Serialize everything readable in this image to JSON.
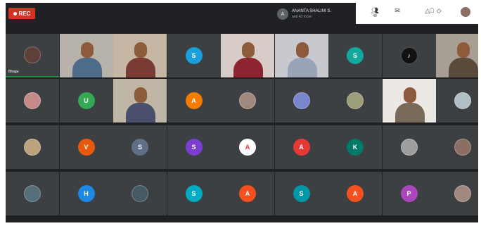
{
  "recording": {
    "label": "REC",
    "accent": "#d93025"
  },
  "presenter": {
    "initial": "A",
    "name": "ANANTA SHALINI S.",
    "status": "and 43 more"
  },
  "controls": {
    "people": {
      "icon": "people-icon",
      "count": "48"
    },
    "chat": {
      "icon": "chat-icon"
    },
    "activities": {
      "icon": "activities-icon"
    },
    "self": {
      "icon": "self-avatar"
    }
  },
  "colors": {
    "background": "#202124",
    "tile": "#3c4043",
    "speaking": "#1e8e3e"
  },
  "tiles": [
    {
      "kind": "photo",
      "initial": "",
      "color": "#5d4037",
      "name": "Bhagu"
    },
    {
      "kind": "video",
      "bg": "#b7b2aa",
      "shirt": "#4e6b8a"
    },
    {
      "kind": "video",
      "bg": "#c6b6a3",
      "shirt": "#7a3b32"
    },
    {
      "kind": "avatar",
      "initial": "S",
      "color": "#1a9fd8"
    },
    {
      "kind": "video",
      "bg": "#d7ccc8",
      "shirt": "#8e2430"
    },
    {
      "kind": "video",
      "bg": "#c8c9cf",
      "shirt": "#9aa4b8"
    },
    {
      "kind": "avatar",
      "initial": "S",
      "color": "#12a89d"
    },
    {
      "kind": "photo",
      "initial": "♪",
      "color": "#111111"
    },
    {
      "kind": "video",
      "bg": "#a89f94",
      "shirt": "#5a4a3a"
    },
    {
      "kind": "photo",
      "initial": "",
      "color": "#c58b89"
    },
    {
      "kind": "avatar",
      "initial": "U",
      "color": "#34a853"
    },
    {
      "kind": "video",
      "bg": "#bfb6a6",
      "shirt": "#4a4f6b"
    },
    {
      "kind": "avatar",
      "initial": "A",
      "color": "#f57c00"
    },
    {
      "kind": "photo",
      "initial": "",
      "color": "#a1887f"
    },
    {
      "kind": "photo",
      "initial": "",
      "color": "#7986cb"
    },
    {
      "kind": "photo",
      "initial": "",
      "color": "#9e9d7a"
    },
    {
      "kind": "video",
      "bg": "#ece8e4",
      "shirt": "#7a6a5a"
    },
    {
      "kind": "photo",
      "initial": "",
      "color": "#b0bec5"
    },
    {
      "kind": "photo",
      "initial": "",
      "color": "#bca27d"
    },
    {
      "kind": "avatar",
      "initial": "V",
      "color": "#e8590c"
    },
    {
      "kind": "avatar",
      "initial": "S",
      "color": "#5f6f86"
    },
    {
      "kind": "avatar",
      "initial": "S",
      "color": "#7b3fcf"
    },
    {
      "kind": "photo",
      "initial": "A",
      "color": "#ffffff"
    },
    {
      "kind": "avatar",
      "initial": "A",
      "color": "#e53935"
    },
    {
      "kind": "avatar",
      "initial": "K",
      "color": "#00796b"
    },
    {
      "kind": "photo",
      "initial": "",
      "color": "#9e9e9e"
    },
    {
      "kind": "photo",
      "initial": "",
      "color": "#8d6e63"
    },
    {
      "kind": "photo",
      "initial": "",
      "color": "#546e7a"
    },
    {
      "kind": "avatar",
      "initial": "H",
      "color": "#1e88e5"
    },
    {
      "kind": "photo",
      "initial": "",
      "color": "#455a64"
    },
    {
      "kind": "avatar",
      "initial": "S",
      "color": "#00acc1"
    },
    {
      "kind": "avatar",
      "initial": "A",
      "color": "#f4511e"
    },
    {
      "kind": "avatar",
      "initial": "S",
      "color": "#0097a7"
    },
    {
      "kind": "avatar",
      "initial": "A",
      "color": "#f4511e"
    },
    {
      "kind": "avatar",
      "initial": "P",
      "color": "#ab47bc"
    },
    {
      "kind": "photo",
      "initial": "",
      "color": "#a1887f"
    }
  ]
}
